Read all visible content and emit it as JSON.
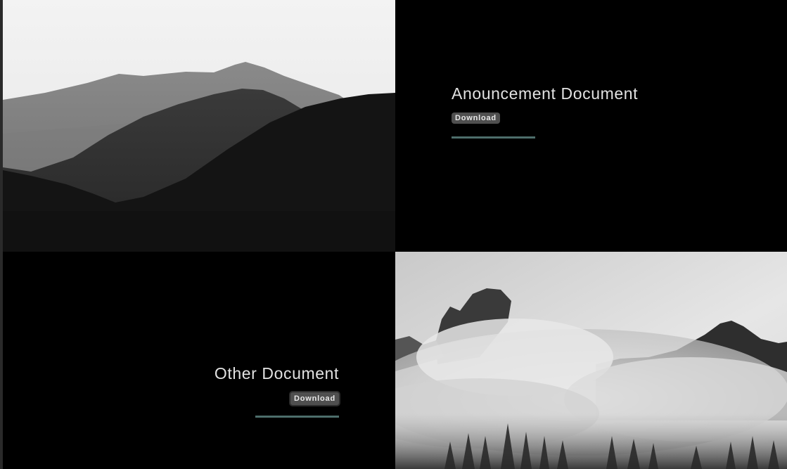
{
  "documents": [
    {
      "title": "Anouncement Document",
      "download_label": "Download",
      "image": "mountain-ridges-photo"
    },
    {
      "title": "Other Document",
      "download_label": "Download",
      "image": "misty-peaks-forest-photo"
    }
  ],
  "colors": {
    "background": "#000000",
    "title_text": "#e2e2e2",
    "button_bg": "#4f4f4f",
    "underline_accent": "#4d6e6b"
  }
}
